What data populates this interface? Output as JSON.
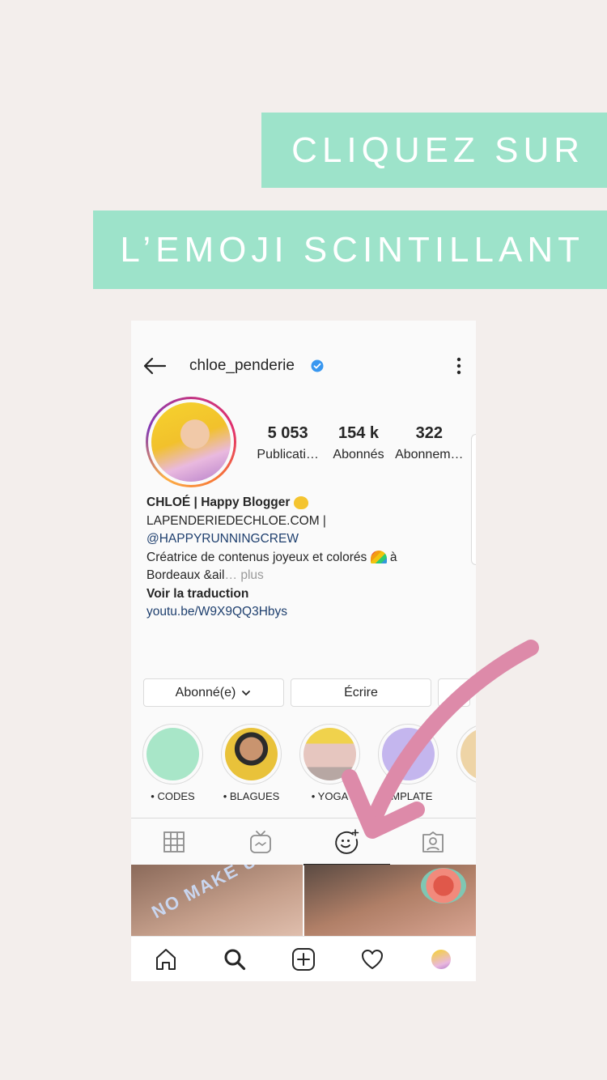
{
  "banners": {
    "line1": "CLIQUEZ SUR",
    "line2": "L’EMOJI SCINTILLANT"
  },
  "profile": {
    "username": "chloe_penderie",
    "stats": [
      {
        "value": "5 053",
        "label": "Publicati…"
      },
      {
        "value": "154 k",
        "label": "Abonnés"
      },
      {
        "value": "322",
        "label": "Abonnem…"
      }
    ],
    "bio": {
      "name": "CHLOÉ | Happy Blogger",
      "line2": "LAPENDERIEDECHLOE.COM |",
      "mention": "@HAPPYRUNNINGCREW",
      "line4": "Créatrice de contenus joyeux et colorés",
      "line4_end": "à",
      "line5": "Bordeaux &ail",
      "more": "… plus",
      "translate": "Voir la traduction",
      "link": "youtu.be/W9X9QQ3Hbys"
    },
    "buttons": {
      "follow": "Abonné(e)",
      "message": "Écrire"
    },
    "highlights": [
      {
        "label": "• CODES",
        "color": "#a8e6c8"
      },
      {
        "label": "• BLAGUES",
        "color": "#6b8fa8"
      },
      {
        "label": "• YOGA",
        "color": "#d9c3bd"
      },
      {
        "label": "EMPLATE",
        "color": "#c4b6ee"
      },
      {
        "label": "•",
        "color": "#eed4a6"
      }
    ],
    "grid_overlay_text": "NO MAKE UP"
  },
  "colors": {
    "banner": "#9de3ca",
    "arrow": "#dd8aa9",
    "verified": "#3897f0",
    "link": "#1e3f6e"
  },
  "icons": {
    "tab_grid": "grid-icon",
    "tab_igtv": "igtv-icon",
    "tab_effects": "sparkle-face-icon",
    "tab_tagged": "tagged-icon",
    "nav_home": "home-icon",
    "nav_search": "search-icon",
    "nav_add": "add-icon",
    "nav_activity": "heart-icon"
  }
}
